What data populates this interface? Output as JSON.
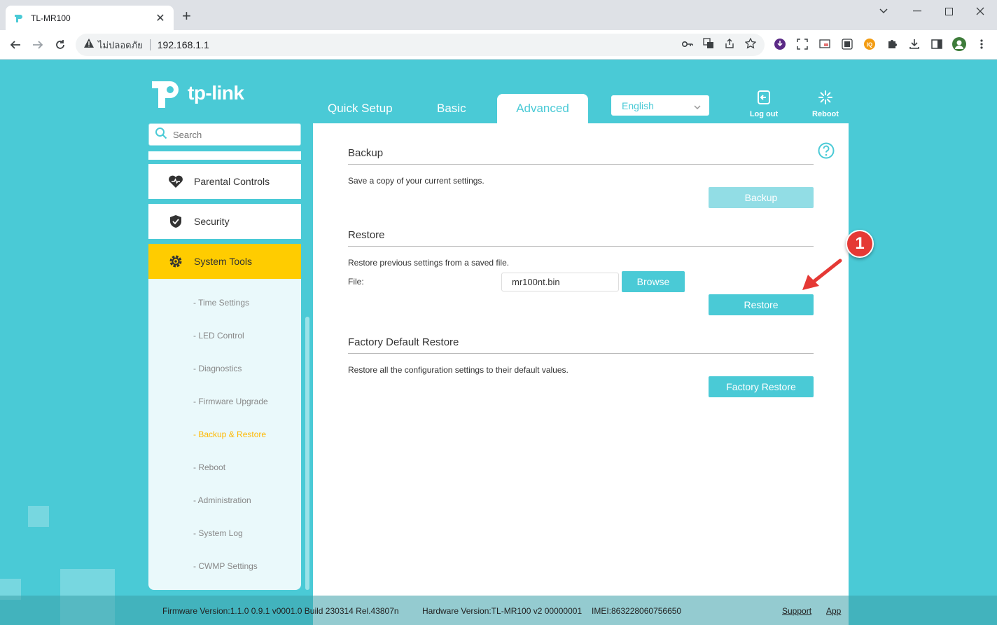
{
  "browser": {
    "tab_title": "TL-MR100",
    "security_label": "ไม่ปลอดภัย",
    "url": "192.168.1.1"
  },
  "header": {
    "logo_text": "tp-link",
    "tabs": {
      "quick_setup": "Quick Setup",
      "basic": "Basic",
      "advanced": "Advanced"
    },
    "language": "English",
    "logout_label": "Log out",
    "reboot_label": "Reboot"
  },
  "sidebar": {
    "search_placeholder": "Search",
    "items": {
      "parental": "Parental Controls",
      "security": "Security",
      "system_tools": "System Tools"
    },
    "submenu": {
      "time": "- Time Settings",
      "led": "- LED Control",
      "diagnostics": "- Diagnostics",
      "firmware": "- Firmware Upgrade",
      "backup_restore": "- Backup & Restore",
      "reboot": "- Reboot",
      "administration": "- Administration",
      "syslog": "- System Log",
      "cwmp": "- CWMP Settings"
    }
  },
  "content": {
    "backup": {
      "title": "Backup",
      "desc": "Save a copy of your current settings.",
      "button": "Backup"
    },
    "restore": {
      "title": "Restore",
      "desc": "Restore previous settings from a saved file.",
      "file_label": "File:",
      "file_value": "mr100nt.bin",
      "browse_button": "Browse",
      "button": "Restore"
    },
    "factory": {
      "title": "Factory Default Restore",
      "desc": "Restore all the configuration settings to their default values.",
      "button": "Factory Restore"
    }
  },
  "annotation": {
    "badge": "1"
  },
  "footer": {
    "firmware": "Firmware Version:1.1.0 0.9.1 v0001.0 Build 230314 Rel.43807n",
    "hardware": "Hardware Version:TL-MR100 v2 00000001",
    "imei": "IMEI:863228060756650",
    "support": "Support",
    "app": "App"
  },
  "colors": {
    "brand": "#4acad6",
    "active_menu": "#ffcc00",
    "annotation": "#e53935"
  }
}
